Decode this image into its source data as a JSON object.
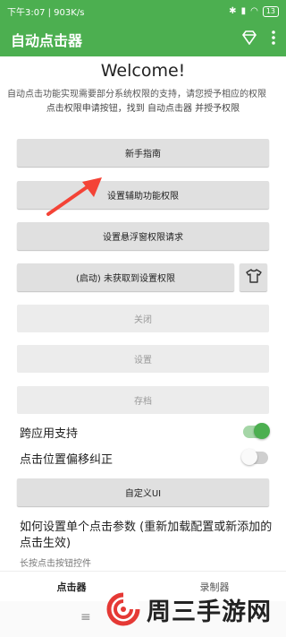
{
  "status_bar": {
    "time_speed": "下午3:07 | 903K/s",
    "battery": "13"
  },
  "app_bar": {
    "title": "自动点击器",
    "diamond_icon": "diamond-icon",
    "more_icon": "more-vert-icon"
  },
  "main": {
    "welcome": "Welcome!",
    "description": "自动点击功能实现需要部分系统权限的支持，请您授予相应的权限",
    "hint": "点击权限申请按钮，找到 自动点击器 并授予权限",
    "buttons": {
      "guide": "新手指南",
      "accessibility": "设置辅助功能权限",
      "overlay": "设置悬浮窗权限请求",
      "start": "(启动) 未获取到设置权限",
      "close": "关闭",
      "settings": "设置",
      "archive": "存档",
      "custom_ui": "自定义UI"
    },
    "toggles": {
      "cross_app_label": "跨应用支持",
      "cross_app_on": true,
      "offset_label": "点击位置偏移纠正",
      "offset_on": false
    },
    "section_title": "如何设置单个点击参数 (重新加载配置或新添加的点击生效)",
    "section_sub": "长按点击按钮控件"
  },
  "bottom_nav": {
    "tabs": [
      "点击器",
      "录制器"
    ],
    "active": 0
  },
  "watermark": {
    "text": "周三手游网"
  },
  "colors": {
    "primary": "#4caf50",
    "arrow": "#f44336"
  }
}
